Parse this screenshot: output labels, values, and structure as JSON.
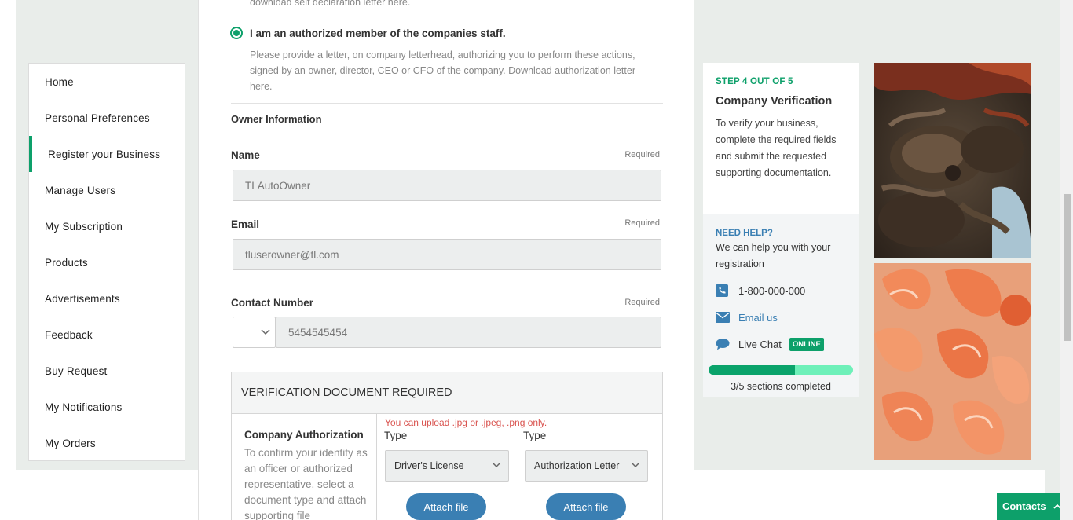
{
  "sidebar": {
    "items": [
      {
        "label": "Home"
      },
      {
        "label": "Personal Preferences"
      },
      {
        "label": "Register your Business"
      },
      {
        "label": "Manage Users"
      },
      {
        "label": "My Subscription"
      },
      {
        "label": "Products"
      },
      {
        "label": "Advertisements"
      },
      {
        "label": "Feedback"
      },
      {
        "label": "Buy Request"
      },
      {
        "label": "My Notifications"
      },
      {
        "label": "My Orders"
      }
    ],
    "active_index": 2
  },
  "form": {
    "faded_text": "download self declaration letter here.",
    "radio_label": "I am an authorized member of the companies staff.",
    "radio_desc": "Please provide a letter, on company letterhead, authorizing you to perform these actions, signed by an owner, director, CEO or CFO of the company. Download authorization letter here.",
    "owner_section": "Owner Information",
    "required": "Required",
    "name_label": "Name",
    "name_value": "TLAutoOwner",
    "email_label": "Email",
    "email_value": "tluserowner@tl.com",
    "contact_label": "Contact Number",
    "contact_value": "5454545454"
  },
  "verification": {
    "header": "VERIFICATION DOCUMENT REQUIRED",
    "left_title": "Company Authorization",
    "left_desc": "To confirm your identity as an officer or authorized representative, select a document type and attach supporting file",
    "upload_note": "You can upload .jpg or .jpeg, .png only.",
    "type_label": "Type",
    "doc1_type": "Driver's License",
    "doc2_type": "Authorization Letter",
    "attach_label": "Attach file"
  },
  "step": {
    "kicker": "STEP 4 OUT OF 5",
    "title": "Company Verification",
    "desc": "To verify your business, complete the required fields and submit the requested supporting documentation.",
    "help_title": "NEED HELP?",
    "help_desc": "We can help you with your registration",
    "phone": "1-800-000-000",
    "email": "Email us",
    "chat": "Live Chat",
    "online": "ONLINE",
    "progress": 0.6,
    "progress_text": "3/5 sections completed"
  },
  "contacts_tab": {
    "label": "Contacts"
  },
  "colors": {
    "accent": "#0da06a",
    "link": "#3a7fb3",
    "error": "#d9534f"
  }
}
